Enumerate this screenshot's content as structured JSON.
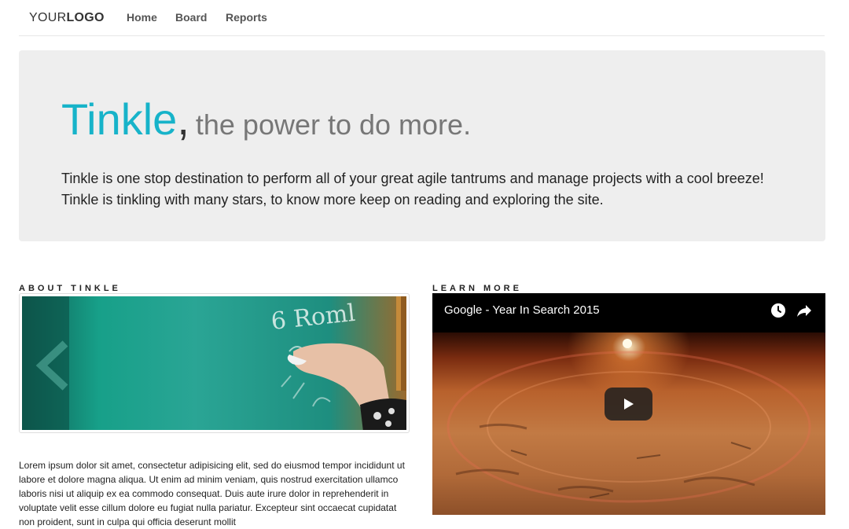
{
  "nav": {
    "logo_light": "YOUR",
    "logo_bold": "LOGO",
    "links": [
      {
        "label": "Home"
      },
      {
        "label": "Board"
      },
      {
        "label": "Reports"
      }
    ]
  },
  "hero": {
    "brand": "Tinkle",
    "comma": ",",
    "tagline": "the power to do more.",
    "lead": "Tinkle is one stop destination to perform all of your great agile tantrums and manage projects with a cool breeze! Tinkle is tinkling with many stars, to know more keep on reading and exploring the site."
  },
  "about": {
    "title": "ABOUT TINKLE",
    "image_text": "6 Roml",
    "text": "Lorem ipsum dolor sit amet, consectetur adipisicing elit, sed do eiusmod tempor incididunt ut labore et dolore magna aliqua. Ut enim ad minim veniam, quis nostrud exercitation ullamco laboris nisi ut aliquip ex ea commodo consequat. Duis aute irure dolor in reprehenderit in voluptate velit esse cillum dolore eu fugiat nulla pariatur. Excepteur sint occaecat cupidatat non proident, sunt in culpa qui officia deserunt mollit"
  },
  "learn": {
    "title": "LEARN MORE",
    "video_title": "Google - Year In Search 2015",
    "icons": [
      "clock-icon",
      "share-icon",
      "play-icon"
    ]
  },
  "colors": {
    "brand": "#17b3c9",
    "jumbotron_bg": "#eeeeee"
  }
}
